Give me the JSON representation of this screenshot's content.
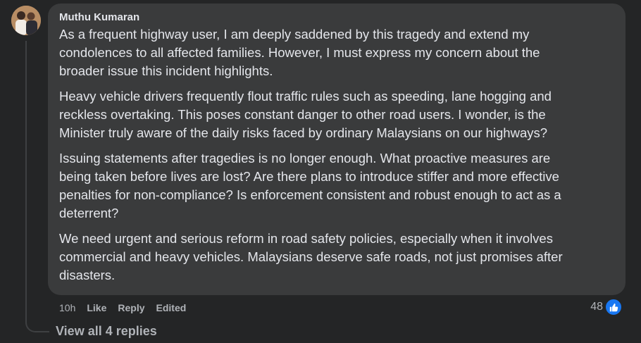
{
  "comment": {
    "author": "Muthu Kumaran",
    "paragraphs": [
      "As a frequent highway user, I am deeply saddened by this tragedy and extend my\ncondolences to all affected families. However, I must express my concern about the\nbroader issue this incident highlights.",
      "Heavy vehicle drivers frequently flout traffic rules such as speeding, lane hogging and\nreckless overtaking. This poses constant danger to other road users. I wonder, is the\nMinister truly aware of the daily risks faced by ordinary Malaysians on our highways?",
      "Issuing statements after tragedies is no longer enough. What proactive measures are\nbeing taken before lives are lost? Are there plans to introduce stiffer and more effective\npenalties for non-compliance? Is enforcement consistent and robust enough to act as a\ndeterrent?",
      "We need urgent and serious reform in road safety policies, especially when it involves\ncommercial and heavy vehicles. Malaysians deserve safe roads, not just promises after\ndisasters."
    ],
    "time": "10h",
    "like_label": "Like",
    "reply_label": "Reply",
    "edited_label": "Edited",
    "reaction_count": "48",
    "reaction_icon": "thumbs-up-icon",
    "view_replies_label": "View all 4 replies"
  },
  "colors": {
    "background": "#242526",
    "bubble": "#3a3b3c",
    "text": "#e4e6eb",
    "secondary_text": "#b0b3b8",
    "like_blue": "#1877f2"
  }
}
